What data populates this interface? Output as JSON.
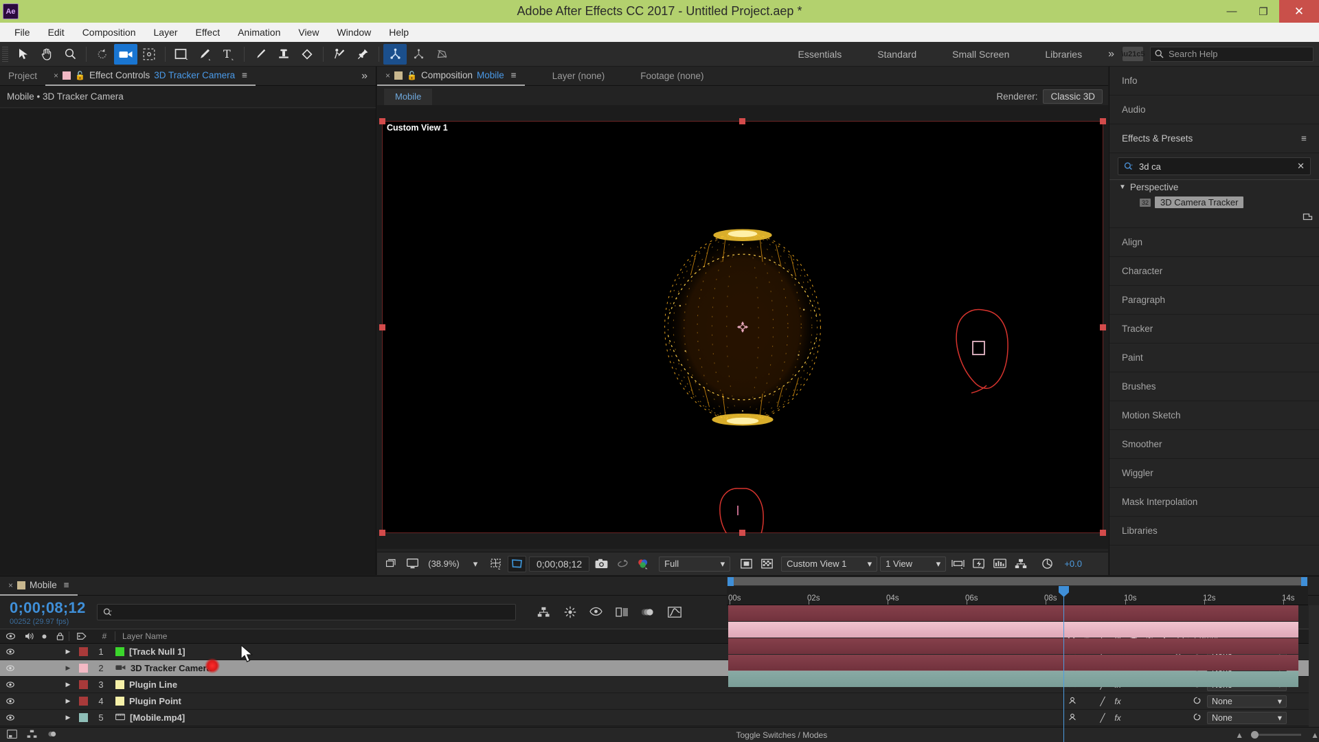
{
  "window": {
    "title": "Adobe After Effects CC 2017 - Untitled Project.aep *",
    "app_badge": "Ae",
    "minimize": "—",
    "restore": "❐",
    "close": "✕",
    "titlebar_color": "#b3d16e"
  },
  "menubar": {
    "items": [
      "File",
      "Edit",
      "Composition",
      "Layer",
      "Effect",
      "Animation",
      "View",
      "Window",
      "Help"
    ]
  },
  "toolbar": {
    "tools": [
      {
        "name": "selection-tool",
        "glyph": "➤",
        "active": false
      },
      {
        "name": "hand-tool",
        "glyph": "✋",
        "active": false
      },
      {
        "name": "zoom-tool",
        "glyph": "⌕",
        "active": false
      },
      {
        "name": "rotation-tool",
        "glyph": "↺",
        "active": false
      },
      {
        "name": "camera-tool",
        "glyph": "🎥",
        "active": true
      },
      {
        "name": "pan-behind-tool",
        "glyph": "⬚",
        "active": false
      },
      {
        "name": "shape-tool",
        "glyph": "■",
        "active": false
      },
      {
        "name": "pen-tool",
        "glyph": "✒",
        "active": false
      },
      {
        "name": "type-tool",
        "glyph": "T",
        "active": false
      },
      {
        "name": "brush-tool",
        "glyph": "╱",
        "active": false
      },
      {
        "name": "clone-stamp-tool",
        "glyph": "⚓",
        "active": false
      },
      {
        "name": "eraser-tool",
        "glyph": "◆",
        "active": false
      },
      {
        "name": "roto-brush-tool",
        "glyph": "὘",
        "active": false
      },
      {
        "name": "puppet-pin-tool",
        "glyph": "✦",
        "active": false
      }
    ],
    "puppet_tools": [
      {
        "name": "puppet-position-pin",
        "active": true
      },
      {
        "name": "puppet-starch-pin",
        "active": false
      },
      {
        "name": "puppet-overlap-pin",
        "active": false
      }
    ],
    "workspaces": [
      "Essentials",
      "Standard",
      "Small Screen",
      "Libraries"
    ],
    "workspace_overflow": "»",
    "search_placeholder": "Search Help"
  },
  "left_panel": {
    "tabs": [
      {
        "label": "Project",
        "active": false,
        "has_close": false
      },
      {
        "label": "Effect Controls",
        "suffix": "3D Tracker Camera",
        "active": true,
        "has_close": true
      }
    ],
    "menu_glyph": "≡",
    "overflow": "»",
    "breadcrumb": "Mobile • 3D Tracker Camera"
  },
  "comp_panel": {
    "tabs": [
      {
        "label": "Composition",
        "suffix": "Mobile",
        "active": true
      },
      {
        "label": "Layer (none)",
        "active": false
      },
      {
        "label": "Footage (none)",
        "active": false
      }
    ],
    "comp_tab": "Mobile",
    "renderer_label": "Renderer:",
    "renderer_value": "Classic 3D",
    "view_label": "Custom View 1",
    "bottom_bar": {
      "zoom": "(38.9%)",
      "timecode": "0;00;08;12",
      "resolution": "Full",
      "view_layout_a": "Custom View 1",
      "view_layout_b": "1 View",
      "exposure": "+0.0",
      "icons": [
        "always-preview-icon",
        "main-viewer-icon",
        "zoom-dropdown-icon",
        "grid-guides-icon",
        "region-of-interest-icon",
        "snapshot-icon",
        "show-snapshot-icon",
        "channel-icon",
        "resolution-dropdown-icon",
        "transparency-grid-icon",
        "toggle-mask-icon",
        "timeline-icon",
        "comp-flowchart-icon",
        "fast-previews-icon"
      ]
    }
  },
  "right_panel": {
    "sections": [
      "Info",
      "Audio"
    ],
    "effects_header": "Effects & Presets",
    "effects_menu_glyph": "≡",
    "search_value": "3d ca",
    "clear_glyph": "✕",
    "category": {
      "label": "Perspective",
      "expanded": true,
      "arrow": "▼"
    },
    "effect_item": {
      "label": "3D Camera Tracker",
      "badge": "32",
      "selected": true
    },
    "panels": [
      "Align",
      "Character",
      "Paragraph",
      "Tracker",
      "Paint",
      "Brushes",
      "Motion Sketch",
      "Smoother",
      "Wiggler",
      "Mask Interpolation",
      "Libraries"
    ]
  },
  "timeline": {
    "tab": {
      "label": "Mobile",
      "close": "×",
      "menu": "≡"
    },
    "timecode": "0;00;08;12",
    "frames": "00252 (29.97 fps)",
    "search_placeholder": "",
    "tool_icons": [
      "composition-mini-flowchart-icon",
      "draft-3d-icon",
      "hide-shy-layers-icon",
      "frame-blending-icon",
      "motion-blur-icon",
      "graph-editor-icon"
    ],
    "columns": {
      "video": "◉",
      "audio": "🔊",
      "solo": "●",
      "lock": "🔒",
      "label": "🏷",
      "number": "#",
      "layer_name": "Layer Name",
      "switches": [
        "⊕",
        "✹",
        "╱",
        "fx",
        "▣",
        "◎",
        "◐",
        "⬡"
      ],
      "parent": "Parent"
    },
    "layers": [
      {
        "num": "1",
        "name": "[Track Null 1]",
        "label_color": "#3bd62c",
        "bar_color": "#7d3540",
        "selected": false,
        "type_icon": "",
        "switches": {
          "shy": true,
          "quality": true,
          "fx": false,
          "threeD": true
        }
      },
      {
        "num": "2",
        "name": "3D Tracker Camera",
        "label_color": "#f3b9c4",
        "bar_color": "#e8b4c0",
        "selected": true,
        "type_icon": "camera-layer-icon",
        "switches": {
          "shy": true,
          "quality": false,
          "fx": false,
          "threeD": false
        }
      },
      {
        "num": "3",
        "name": "Plugin Line",
        "label_color": "#f5f0a8",
        "bar_color": "#7d3540",
        "selected": false,
        "type_icon": "",
        "switches": {
          "shy": true,
          "quality": true,
          "fx": true,
          "threeD": false
        }
      },
      {
        "num": "4",
        "name": "Plugin Point",
        "label_color": "#f5f0a8",
        "bar_color": "#7d3540",
        "selected": false,
        "type_icon": "",
        "switches": {
          "shy": true,
          "quality": true,
          "fx": true,
          "threeD": false
        }
      },
      {
        "num": "5",
        "name": "[Mobile.mp4]",
        "label_color": "#8fbfb8",
        "bar_color": "#7d9e98",
        "selected": false,
        "type_icon": "footage-layer-icon",
        "switches": {
          "shy": true,
          "quality": true,
          "fx": true,
          "threeD": false
        }
      }
    ],
    "parent_value": "None",
    "ruler_ticks": [
      "00s",
      "02s",
      "04s",
      "06s",
      "08s",
      "10s",
      "12s",
      "14s"
    ],
    "playhead_time": "08s",
    "status": "Toggle Switches / Modes"
  },
  "viewport": {
    "label": "Custom View 1",
    "background": "#000000",
    "sphere_color": "#ffb320",
    "mask_color": "#d8342e"
  }
}
